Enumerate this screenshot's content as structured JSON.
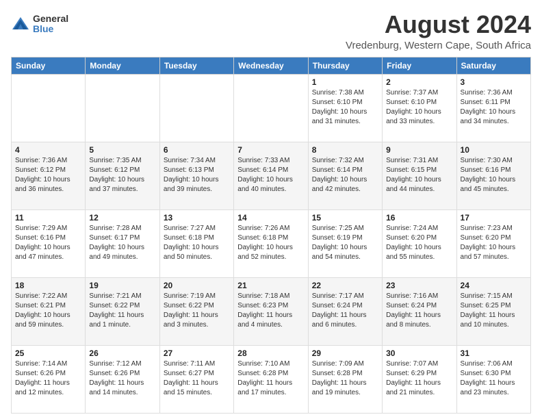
{
  "logo": {
    "general": "General",
    "blue": "Blue"
  },
  "title": {
    "month_year": "August 2024",
    "location": "Vredenburg, Western Cape, South Africa"
  },
  "headers": [
    "Sunday",
    "Monday",
    "Tuesday",
    "Wednesday",
    "Thursday",
    "Friday",
    "Saturday"
  ],
  "weeks": [
    [
      {
        "day": "",
        "info": ""
      },
      {
        "day": "",
        "info": ""
      },
      {
        "day": "",
        "info": ""
      },
      {
        "day": "",
        "info": ""
      },
      {
        "day": "1",
        "info": "Sunrise: 7:38 AM\nSunset: 6:10 PM\nDaylight: 10 hours\nand 31 minutes."
      },
      {
        "day": "2",
        "info": "Sunrise: 7:37 AM\nSunset: 6:10 PM\nDaylight: 10 hours\nand 33 minutes."
      },
      {
        "day": "3",
        "info": "Sunrise: 7:36 AM\nSunset: 6:11 PM\nDaylight: 10 hours\nand 34 minutes."
      }
    ],
    [
      {
        "day": "4",
        "info": "Sunrise: 7:36 AM\nSunset: 6:12 PM\nDaylight: 10 hours\nand 36 minutes."
      },
      {
        "day": "5",
        "info": "Sunrise: 7:35 AM\nSunset: 6:12 PM\nDaylight: 10 hours\nand 37 minutes."
      },
      {
        "day": "6",
        "info": "Sunrise: 7:34 AM\nSunset: 6:13 PM\nDaylight: 10 hours\nand 39 minutes."
      },
      {
        "day": "7",
        "info": "Sunrise: 7:33 AM\nSunset: 6:14 PM\nDaylight: 10 hours\nand 40 minutes."
      },
      {
        "day": "8",
        "info": "Sunrise: 7:32 AM\nSunset: 6:14 PM\nDaylight: 10 hours\nand 42 minutes."
      },
      {
        "day": "9",
        "info": "Sunrise: 7:31 AM\nSunset: 6:15 PM\nDaylight: 10 hours\nand 44 minutes."
      },
      {
        "day": "10",
        "info": "Sunrise: 7:30 AM\nSunset: 6:16 PM\nDaylight: 10 hours\nand 45 minutes."
      }
    ],
    [
      {
        "day": "11",
        "info": "Sunrise: 7:29 AM\nSunset: 6:16 PM\nDaylight: 10 hours\nand 47 minutes."
      },
      {
        "day": "12",
        "info": "Sunrise: 7:28 AM\nSunset: 6:17 PM\nDaylight: 10 hours\nand 49 minutes."
      },
      {
        "day": "13",
        "info": "Sunrise: 7:27 AM\nSunset: 6:18 PM\nDaylight: 10 hours\nand 50 minutes."
      },
      {
        "day": "14",
        "info": "Sunrise: 7:26 AM\nSunset: 6:18 PM\nDaylight: 10 hours\nand 52 minutes."
      },
      {
        "day": "15",
        "info": "Sunrise: 7:25 AM\nSunset: 6:19 PM\nDaylight: 10 hours\nand 54 minutes."
      },
      {
        "day": "16",
        "info": "Sunrise: 7:24 AM\nSunset: 6:20 PM\nDaylight: 10 hours\nand 55 minutes."
      },
      {
        "day": "17",
        "info": "Sunrise: 7:23 AM\nSunset: 6:20 PM\nDaylight: 10 hours\nand 57 minutes."
      }
    ],
    [
      {
        "day": "18",
        "info": "Sunrise: 7:22 AM\nSunset: 6:21 PM\nDaylight: 10 hours\nand 59 minutes."
      },
      {
        "day": "19",
        "info": "Sunrise: 7:21 AM\nSunset: 6:22 PM\nDaylight: 11 hours\nand 1 minute."
      },
      {
        "day": "20",
        "info": "Sunrise: 7:19 AM\nSunset: 6:22 PM\nDaylight: 11 hours\nand 3 minutes."
      },
      {
        "day": "21",
        "info": "Sunrise: 7:18 AM\nSunset: 6:23 PM\nDaylight: 11 hours\nand 4 minutes."
      },
      {
        "day": "22",
        "info": "Sunrise: 7:17 AM\nSunset: 6:24 PM\nDaylight: 11 hours\nand 6 minutes."
      },
      {
        "day": "23",
        "info": "Sunrise: 7:16 AM\nSunset: 6:24 PM\nDaylight: 11 hours\nand 8 minutes."
      },
      {
        "day": "24",
        "info": "Sunrise: 7:15 AM\nSunset: 6:25 PM\nDaylight: 11 hours\nand 10 minutes."
      }
    ],
    [
      {
        "day": "25",
        "info": "Sunrise: 7:14 AM\nSunset: 6:26 PM\nDaylight: 11 hours\nand 12 minutes."
      },
      {
        "day": "26",
        "info": "Sunrise: 7:12 AM\nSunset: 6:26 PM\nDaylight: 11 hours\nand 14 minutes."
      },
      {
        "day": "27",
        "info": "Sunrise: 7:11 AM\nSunset: 6:27 PM\nDaylight: 11 hours\nand 15 minutes."
      },
      {
        "day": "28",
        "info": "Sunrise: 7:10 AM\nSunset: 6:28 PM\nDaylight: 11 hours\nand 17 minutes."
      },
      {
        "day": "29",
        "info": "Sunrise: 7:09 AM\nSunset: 6:28 PM\nDaylight: 11 hours\nand 19 minutes."
      },
      {
        "day": "30",
        "info": "Sunrise: 7:07 AM\nSunset: 6:29 PM\nDaylight: 11 hours\nand 21 minutes."
      },
      {
        "day": "31",
        "info": "Sunrise: 7:06 AM\nSunset: 6:30 PM\nDaylight: 11 hours\nand 23 minutes."
      }
    ]
  ]
}
